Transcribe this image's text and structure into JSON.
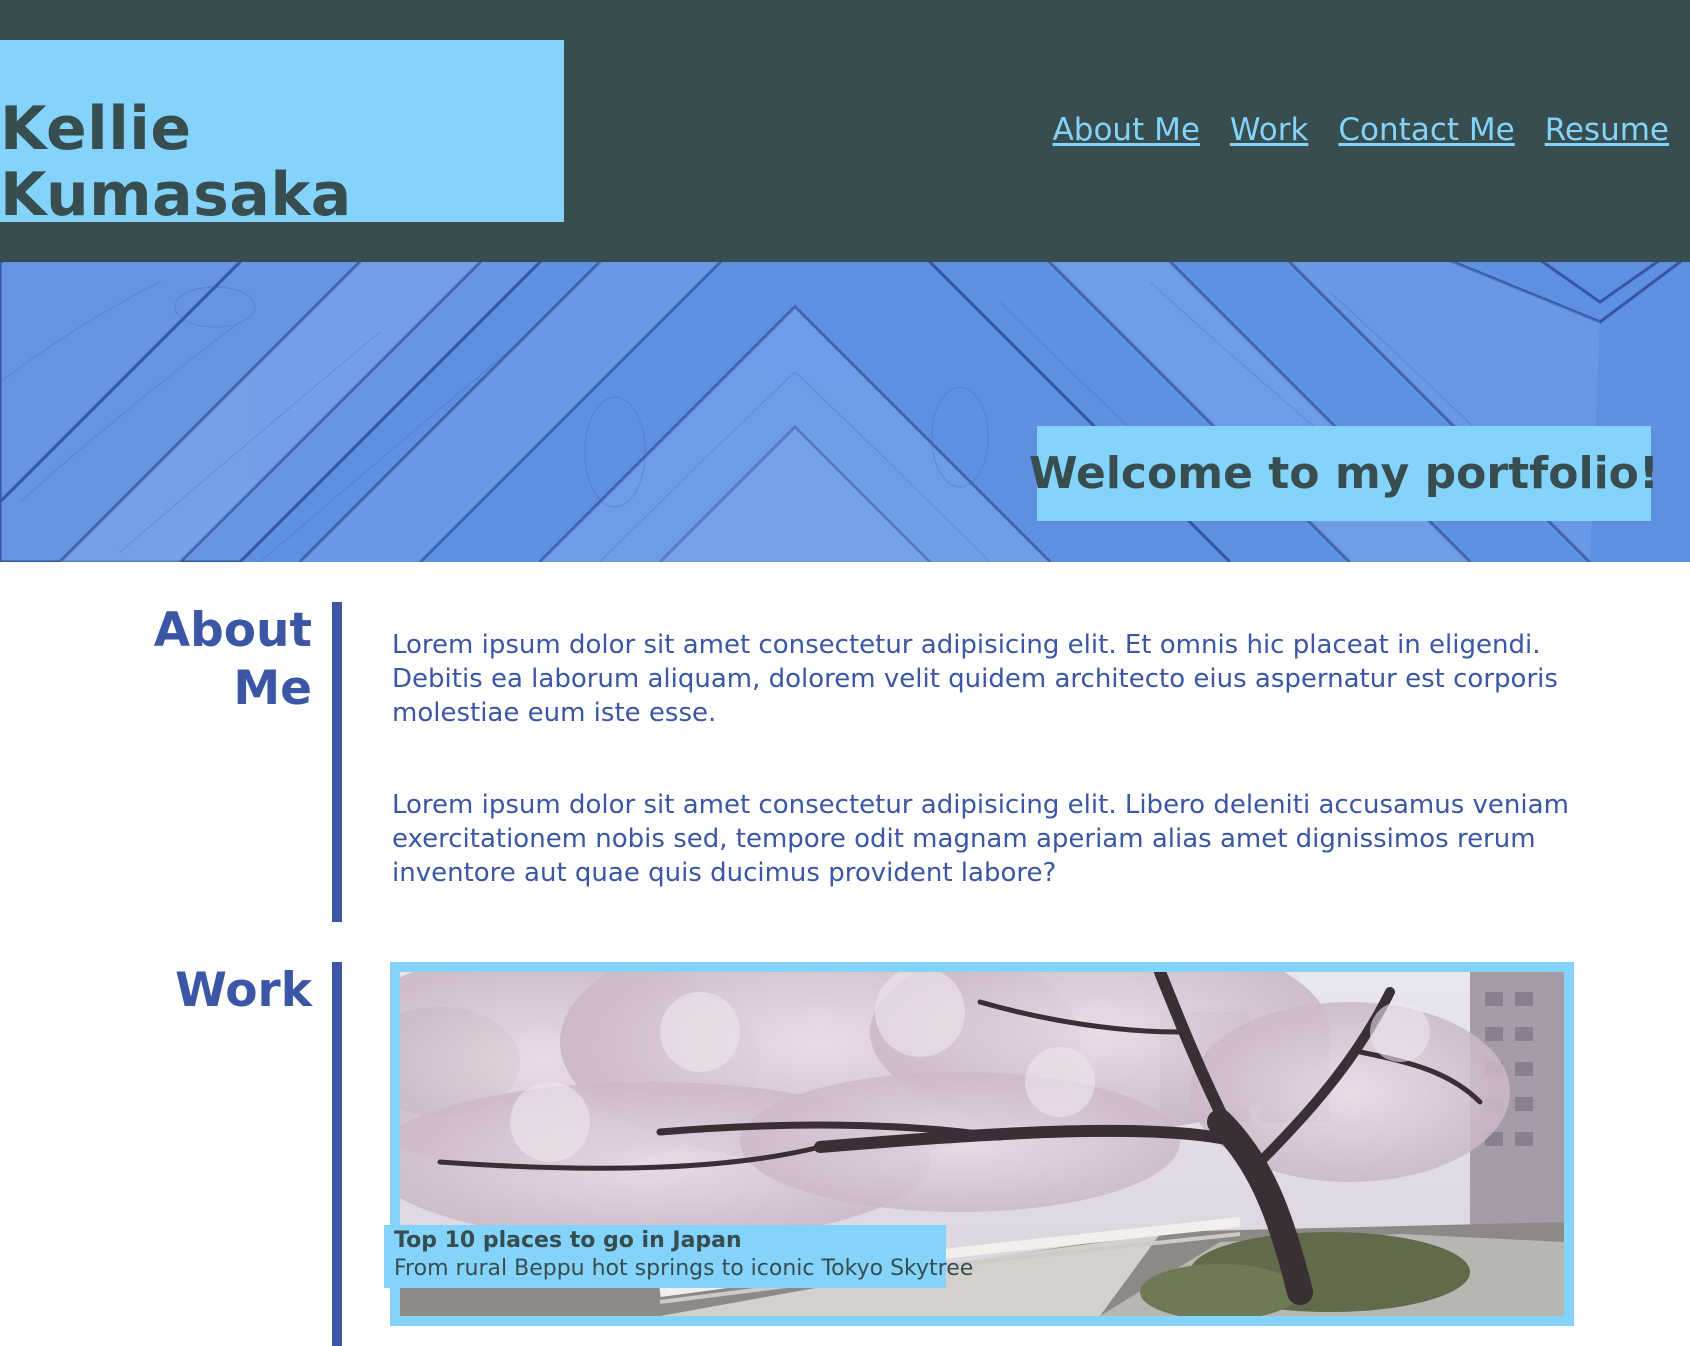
{
  "header": {
    "name": "Kellie Kumasaka",
    "nav": [
      "About Me",
      "Work",
      "Contact Me",
      "Resume"
    ]
  },
  "hero": {
    "welcome": "Welcome to my portfolio!"
  },
  "about": {
    "title_line1": "About",
    "title_line2": "Me",
    "paragraphs": [
      "Lorem ipsum dolor sit amet consectetur adipisicing elit. Et omnis hic placeat in eligendi. Debitis ea laborum aliquam, dolorem velit quidem architecto eius aspernatur est corporis molestiae eum iste esse.",
      "Lorem ipsum dolor sit amet consectetur adipisicing elit. Libero deleniti accusamus veniam exercitationem nobis sed, tempore odit magnam aperiam alias amet dignissimos rerum inventore aut quae quis ducimus provident labore?"
    ]
  },
  "work": {
    "title": "Work",
    "card": {
      "title": "Top 10 places to go in Japan",
      "subtitle": "From rural Beppu hot springs to iconic Tokyo Skytree"
    }
  },
  "colors": {
    "header_bg": "#374d50",
    "accent_light_blue": "#84d3fa",
    "section_blue": "#3a56a5"
  }
}
